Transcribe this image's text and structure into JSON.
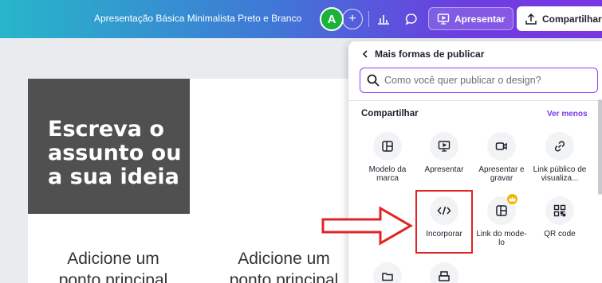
{
  "topbar": {
    "doc_title": "Apresentação Básica Minimalista Preto e Branco",
    "avatar_letter": "A",
    "plus": "+",
    "present_label": "Apresentar",
    "share_label": "Compartilhar"
  },
  "canvas": {
    "headline": "Escreva o assunto ou a sua ideia",
    "points": [
      "Adicione um ponto principal",
      "Adicione um ponto principal"
    ]
  },
  "panel": {
    "back_label": "Mais formas de publicar",
    "search_placeholder": "Como você quer publicar o design?",
    "section_title": "Compartilhar",
    "see_less": "Ver menos",
    "options": [
      {
        "label": "Modelo da marca",
        "icon": "brand-template-icon"
      },
      {
        "label": "Apresentar",
        "icon": "present-icon"
      },
      {
        "label": "Apresentar e gravar",
        "icon": "record-icon"
      },
      {
        "label": "Link público de visualiza...",
        "icon": "link-icon"
      },
      {
        "label": "Incorporar",
        "icon": "embed-icon"
      },
      {
        "label": "Link do mode-lo",
        "icon": "template-link-icon",
        "premium": true
      },
      {
        "label": "QR code",
        "icon": "qr-code-icon"
      }
    ]
  },
  "colors": {
    "accent": "#8b3dff",
    "highlight": "#e02424"
  }
}
